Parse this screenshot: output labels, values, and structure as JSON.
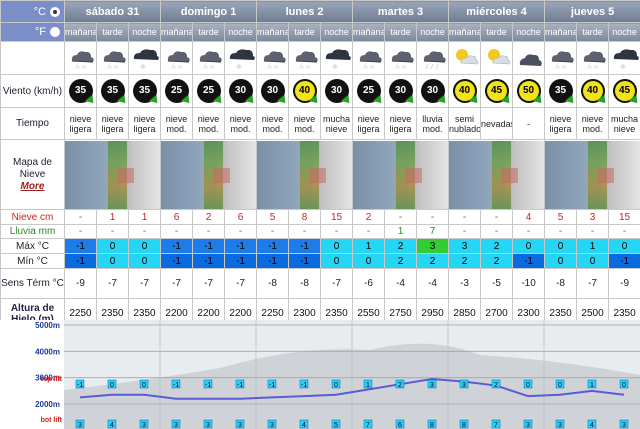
{
  "units": {
    "celsius": "°C",
    "fahrenheit": "°F",
    "selected": "celsius"
  },
  "days": [
    {
      "name": "sábado 31"
    },
    {
      "name": "domingo 1"
    },
    {
      "name": "lunes 2"
    },
    {
      "name": "martes 3"
    },
    {
      "name": "miércoles 4"
    },
    {
      "name": "jueves 5"
    }
  ],
  "periods": [
    "mañana",
    "tarde",
    "noche",
    "mañana",
    "tarde",
    "noche",
    "mañana",
    "tarde",
    "noche",
    "mañana",
    "tarde",
    "noche",
    "mañana",
    "tarde",
    "noche",
    "mañana",
    "tarde",
    "noche"
  ],
  "sky_icons": [
    "cloud-snow-icon",
    "cloud-snow-icon",
    "night-snow-icon",
    "cloud-snow-icon",
    "cloud-snow-icon",
    "night-snow-icon",
    "cloud-snow-icon",
    "cloud-snow-icon",
    "night-snow-icon",
    "cloud-snow-icon",
    "cloud-snow-icon",
    "cloud-rain-icon",
    "sun-cloud-icon",
    "sun-cloud-icon",
    "cloud-icon",
    "cloud-snow-icon",
    "cloud-snow-icon",
    "night-snow-icon"
  ],
  "labels": {
    "wind": "Viento (km/h)",
    "weather": "Tiempo",
    "map_line1": "Mapa de",
    "map_line2": "Nieve",
    "more": "More",
    "snow": "Nieve cm",
    "rain": "Lluvia mm",
    "max": "Máx °C",
    "min": "Mín °C",
    "sens": "Sens Térm °C",
    "altitude": "Altura de Hielo (m)"
  },
  "wind": [
    35,
    35,
    35,
    25,
    25,
    30,
    30,
    40,
    30,
    25,
    30,
    30,
    40,
    45,
    50,
    35,
    40,
    45
  ],
  "wind_yellow": [
    false,
    false,
    false,
    false,
    false,
    false,
    false,
    true,
    false,
    false,
    false,
    false,
    true,
    true,
    true,
    false,
    true,
    true
  ],
  "weather": [
    "nieve ligera",
    "nieve ligera",
    "nieve ligera",
    "nieve mod.",
    "nieve mod.",
    "nieve mod.",
    "nieve mod.",
    "nieve mod.",
    "mucha nieve",
    "nieve ligera",
    "nieve ligera",
    "lluvia mod.",
    "semi nublado",
    "nevadas",
    "-",
    "nieve ligera",
    "nieve mod.",
    "mucha nieve"
  ],
  "snow": [
    "-",
    "1",
    "1",
    "6",
    "2",
    "6",
    "5",
    "8",
    "15",
    "2",
    "-",
    "-",
    "-",
    "-",
    "4",
    "5",
    "3",
    "15"
  ],
  "rain": [
    "-",
    "-",
    "-",
    "-",
    "-",
    "-",
    "-",
    "-",
    "-",
    "-",
    "1",
    "7",
    "-",
    "-",
    "-",
    "-",
    "-",
    "-"
  ],
  "max": [
    "-1",
    "0",
    "0",
    "-1",
    "-1",
    "-1",
    "-1",
    "-1",
    "0",
    "1",
    "2",
    "3",
    "3",
    "2",
    "0",
    "0",
    "1",
    "0"
  ],
  "max_colors": [
    "blue",
    "cyan",
    "cyan",
    "blue",
    "blue",
    "blue",
    "blue",
    "blue",
    "cyan",
    "cyan",
    "cyan",
    "green",
    "cyan",
    "cyan",
    "cyan",
    "cyan",
    "cyan",
    "cyan"
  ],
  "min": [
    "-1",
    "0",
    "0",
    "-1",
    "-1",
    "-1",
    "-1",
    "-1",
    "0",
    "0",
    "2",
    "2",
    "2",
    "2",
    "-1",
    "0",
    "0",
    "-1"
  ],
  "min_colors": [
    "dark",
    "cyan",
    "cyan",
    "dark",
    "dark",
    "dark",
    "dark",
    "dark",
    "cyan",
    "cyan",
    "cyan",
    "cyan",
    "cyan",
    "cyan",
    "dark",
    "cyan",
    "cyan",
    "dark"
  ],
  "sens": [
    "-9",
    "-7",
    "-7",
    "-7",
    "-7",
    "-7",
    "-8",
    "-8",
    "-7",
    "-6",
    "-4",
    "-4",
    "-3",
    "-5",
    "-10",
    "-8",
    "-7",
    "-9"
  ],
  "altitude": [
    "2250",
    "2350",
    "2350",
    "2200",
    "2200",
    "2200",
    "2250",
    "2300",
    "2350",
    "2550",
    "2750",
    "2950",
    "2850",
    "2700",
    "2300",
    "2350",
    "2500",
    "2350"
  ],
  "altitude_chart": {
    "axis_labels": [
      "5000m",
      "4000m",
      "3000m",
      "2000m"
    ],
    "top_label": "top lift",
    "bot_label": "bot lift",
    "top_temps": [
      "-1",
      "0",
      "0",
      "-1",
      "-1",
      "-1",
      "-1",
      "-1",
      "0",
      "1",
      "2",
      "3",
      "3",
      "2",
      "0",
      "0",
      "1",
      "0"
    ],
    "bot_temps": [
      "3",
      "4",
      "3",
      "3",
      "3",
      "3",
      "3",
      "4",
      "5",
      "7",
      "6",
      "8",
      "8",
      "7",
      "3",
      "3",
      "4",
      "3"
    ]
  }
}
